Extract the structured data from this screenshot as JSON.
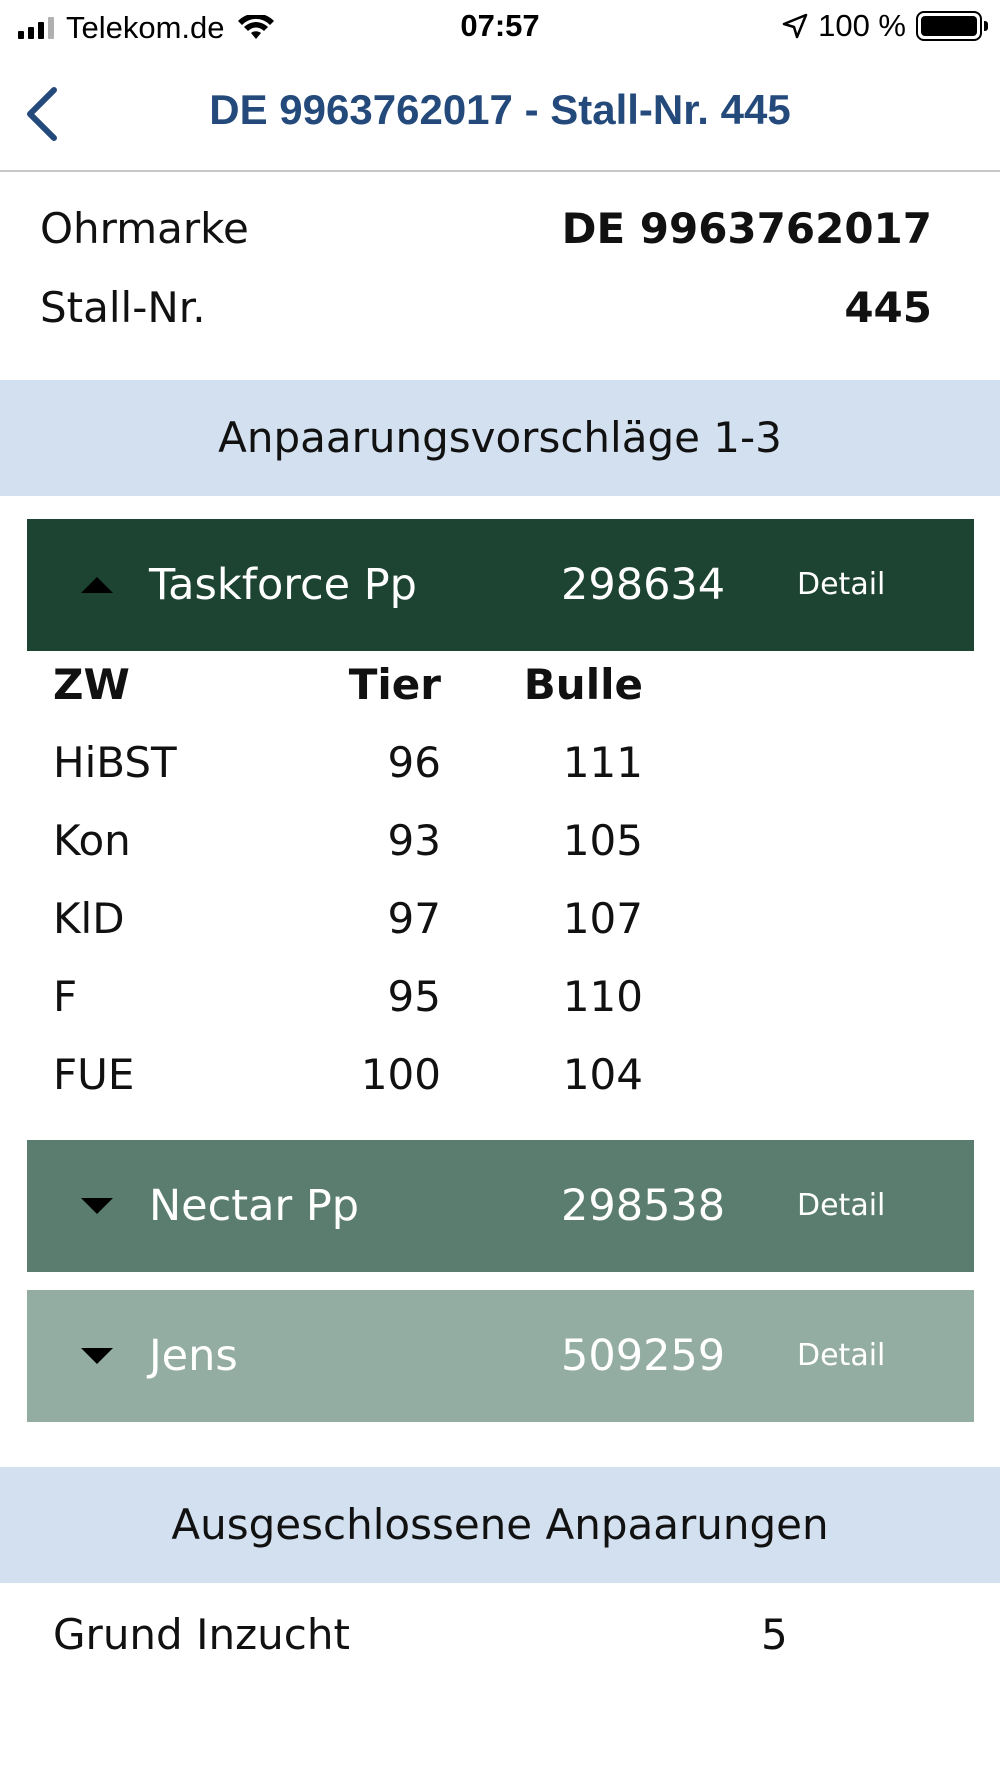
{
  "status_bar": {
    "carrier": "Telekom.de",
    "time": "07:57",
    "battery": "100 %",
    "icons": [
      "signal-icon",
      "wifi-icon",
      "location-arrow-icon",
      "battery-icon"
    ]
  },
  "nav": {
    "title": "DE 9963762017 - Stall-Nr. 445",
    "back_icon": "chevron-left-icon"
  },
  "animal": {
    "ohrmarke_label": "Ohrmarke",
    "ohrmarke_value": "DE 9963762017",
    "stall_label": "Stall-Nr.",
    "stall_value": "445"
  },
  "suggestions_header": "Anpaarungsvorschläge 1-3",
  "bulls": [
    {
      "name": "Taskforce Pp",
      "number": "298634",
      "detail": "Detail",
      "expanded": true,
      "color": "#1d4432"
    },
    {
      "name": "Nectar Pp",
      "number": "298538",
      "detail": "Detail",
      "expanded": false,
      "color": "#5b7d6f"
    },
    {
      "name": "Jens",
      "number": "509259",
      "detail": "Detail",
      "expanded": false,
      "color": "#94ada3"
    }
  ],
  "table": {
    "headers": [
      "ZW",
      "Tier",
      "Bulle"
    ],
    "rows": [
      [
        "HiBST",
        "96",
        "111"
      ],
      [
        "Kon",
        "93",
        "105"
      ],
      [
        "KlD",
        "97",
        "107"
      ],
      [
        "F",
        "95",
        "110"
      ],
      [
        "FUE",
        "100",
        "104"
      ]
    ]
  },
  "excluded_header": "Ausgeschlossene Anpaarungen",
  "excluded": {
    "label": "Grund Inzucht",
    "value": "5"
  }
}
